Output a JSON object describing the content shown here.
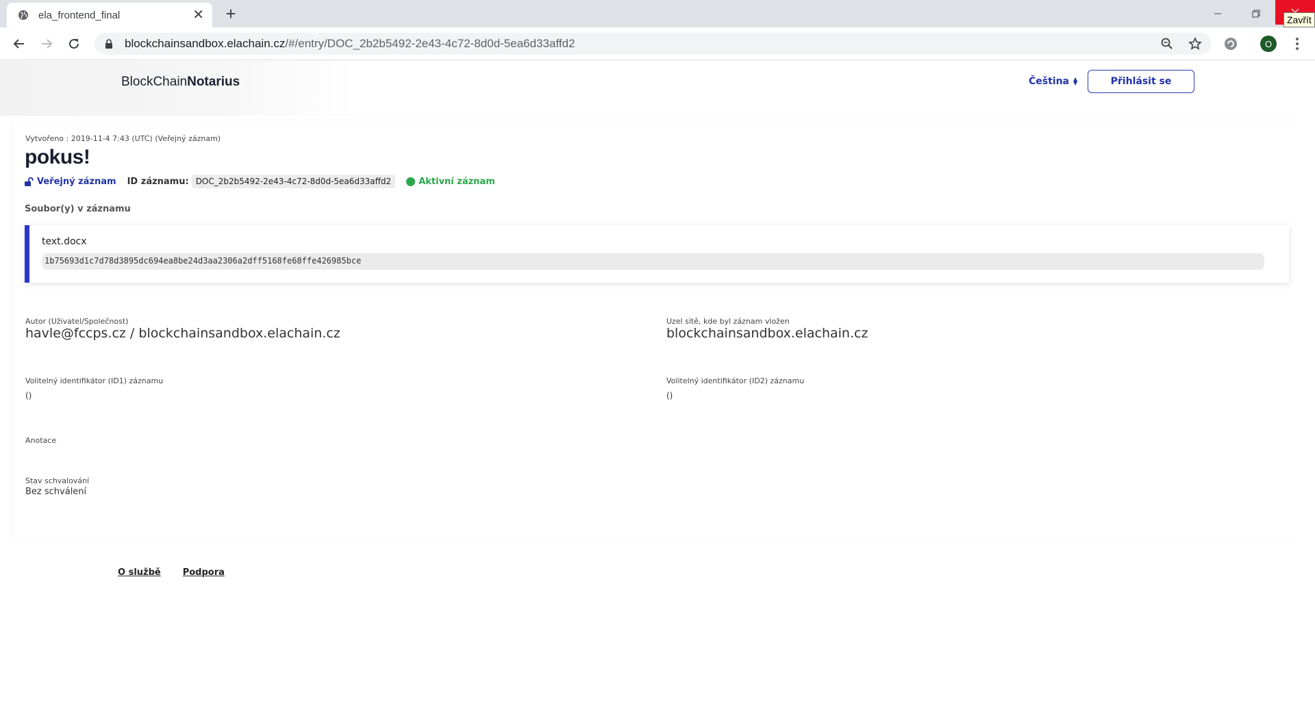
{
  "browser": {
    "tab_title": "ela_frontend_final",
    "url_host": "blockchainsandbox.elachain.cz",
    "url_path": "/#/entry/DOC_2b2b5492-2e43-4c72-8d0d-5ea6d33affd2",
    "close_tooltip": "Zavřít",
    "profile_initial": "O"
  },
  "header": {
    "brand_light": "BlockChain",
    "brand_bold": "Notarius",
    "language": "Čeština",
    "login_label": "Přihlásit se"
  },
  "entry": {
    "created": "Vytvořeno : 2019-11-4 7:43 (UTC) (Veřejný záznam)",
    "title": "pokus!",
    "public_label": "Veřejný záznam",
    "id_label": "ID záznamu:",
    "id_value": "DOC_2b2b5492-2e43-4c72-8d0d-5ea6d33affd2",
    "status": "Aktivní záznam",
    "files_label": "Soubor(y) v záznamu",
    "files": [
      {
        "name": "text.docx",
        "hash": "1b75693d1c7d78d3895dc694ea8be24d3aa2306a2dff5168fe68ffe426985bce"
      }
    ],
    "author_label": "Autor (Uživatel/Společnost)",
    "author_value": "havle@fccps.cz / blockchainsandbox.elachain.cz",
    "node_label": "Uzel sítě, kde byl záznam vložen",
    "node_value": "blockchainsandbox.elachain.cz",
    "id1_label": "Volitelný identifikátor (ID1) záznamu",
    "id1_value": "()",
    "id2_label": "Volitelný identifikátor (ID2) záznamu",
    "id2_value": "()",
    "annotation_label": "Anotace",
    "approval_label": "Stav schvalování",
    "approval_value": "Bez schválení"
  },
  "footer": {
    "about": "O službě",
    "support": "Podpora"
  }
}
